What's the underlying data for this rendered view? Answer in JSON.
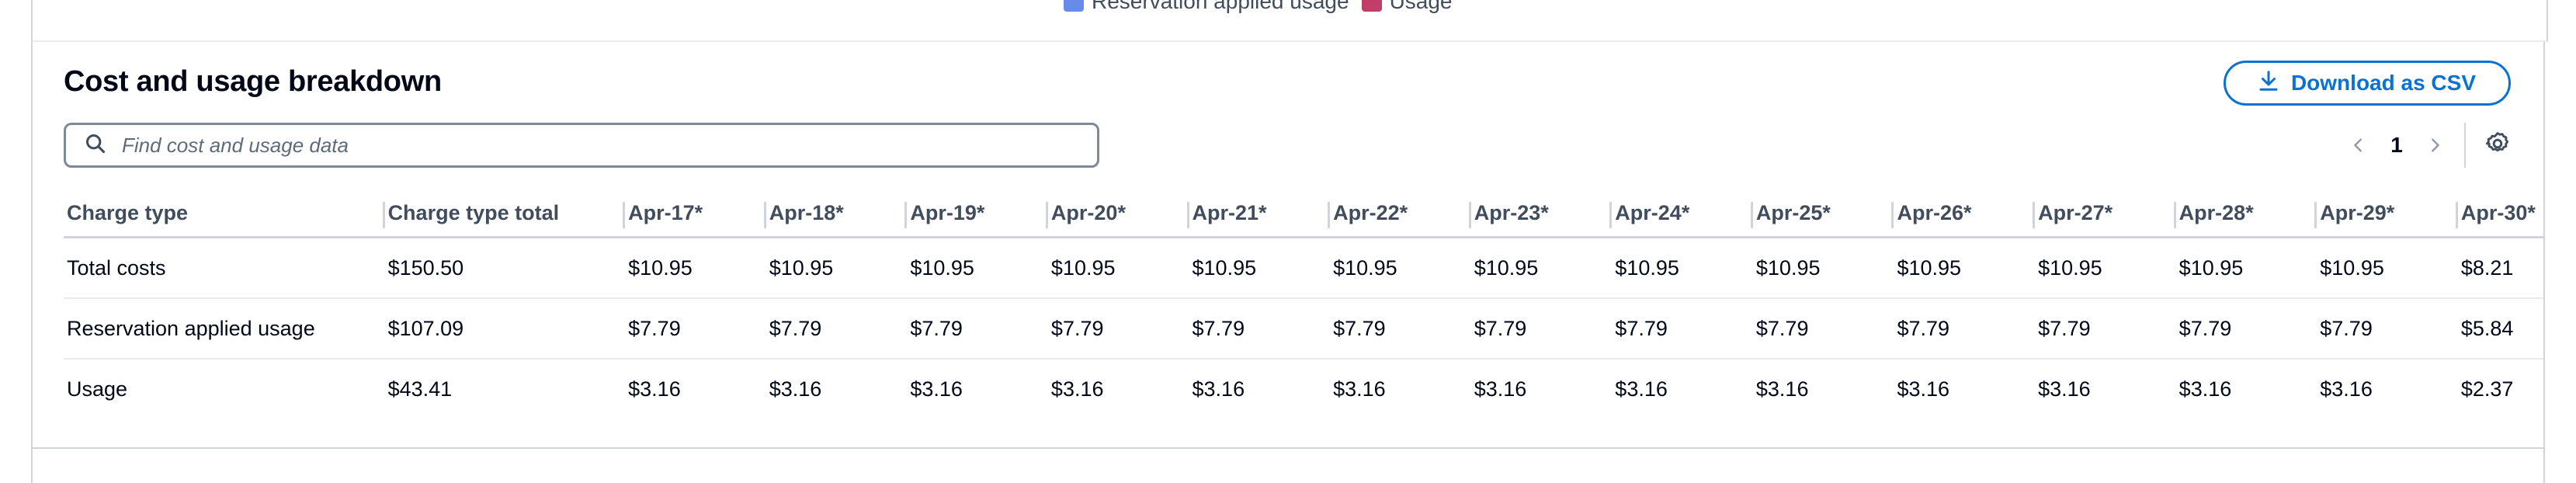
{
  "legend": {
    "items": [
      {
        "label": "Reservation applied usage",
        "color": "#688ae8"
      },
      {
        "label": "Usage",
        "color": "#c33d69"
      }
    ]
  },
  "panel": {
    "title": "Cost and usage breakdown",
    "download_label": "Download as CSV",
    "search_placeholder": "Find cost and usage data",
    "page_number": "1"
  },
  "table": {
    "columns": [
      "Charge type",
      "Charge type total",
      "Apr-17*",
      "Apr-18*",
      "Apr-19*",
      "Apr-20*",
      "Apr-21*",
      "Apr-22*",
      "Apr-23*",
      "Apr-24*",
      "Apr-25*",
      "Apr-26*",
      "Apr-27*",
      "Apr-28*",
      "Apr-29*",
      "Apr-30*"
    ],
    "rows": [
      [
        "Total costs",
        "$150.50",
        "$10.95",
        "$10.95",
        "$10.95",
        "$10.95",
        "$10.95",
        "$10.95",
        "$10.95",
        "$10.95",
        "$10.95",
        "$10.95",
        "$10.95",
        "$10.95",
        "$10.95",
        "$8.21"
      ],
      [
        "Reservation applied usage",
        "$107.09",
        "$7.79",
        "$7.79",
        "$7.79",
        "$7.79",
        "$7.79",
        "$7.79",
        "$7.79",
        "$7.79",
        "$7.79",
        "$7.79",
        "$7.79",
        "$7.79",
        "$7.79",
        "$5.84"
      ],
      [
        "Usage",
        "$43.41",
        "$3.16",
        "$3.16",
        "$3.16",
        "$3.16",
        "$3.16",
        "$3.16",
        "$3.16",
        "$3.16",
        "$3.16",
        "$3.16",
        "$3.16",
        "$3.16",
        "$3.16",
        "$2.37"
      ]
    ]
  }
}
